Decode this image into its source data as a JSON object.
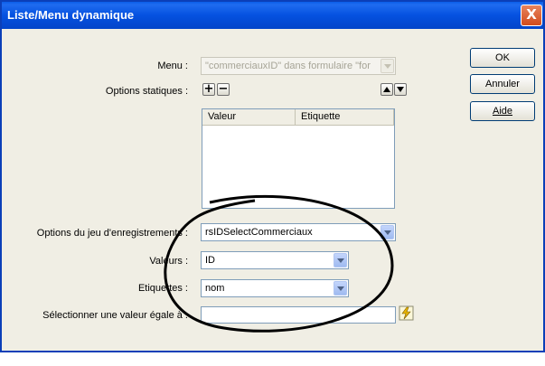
{
  "window": {
    "title": "Liste/Menu dynamique",
    "close_symbol": "X"
  },
  "menu": {
    "label": "Menu :",
    "value": "\"commerciauxID\" dans formulaire \"for"
  },
  "static_options": {
    "label": "Options statiques :",
    "add_symbol": "+",
    "remove_symbol": "−",
    "columns": [
      "Valeur",
      "Etiquette"
    ]
  },
  "recordset": {
    "label": "Options du jeu d'enregistrements :",
    "value": "rsIDSelectCommerciaux"
  },
  "values": {
    "label": "Valeurs :",
    "value": "ID"
  },
  "labels": {
    "label": "Etiquettes :",
    "value": "nom"
  },
  "select_equal": {
    "label": "Sélectionner une valeur égale à :",
    "value": ""
  },
  "buttons": {
    "ok": "OK",
    "cancel": "Annuler",
    "help": "Aide"
  }
}
